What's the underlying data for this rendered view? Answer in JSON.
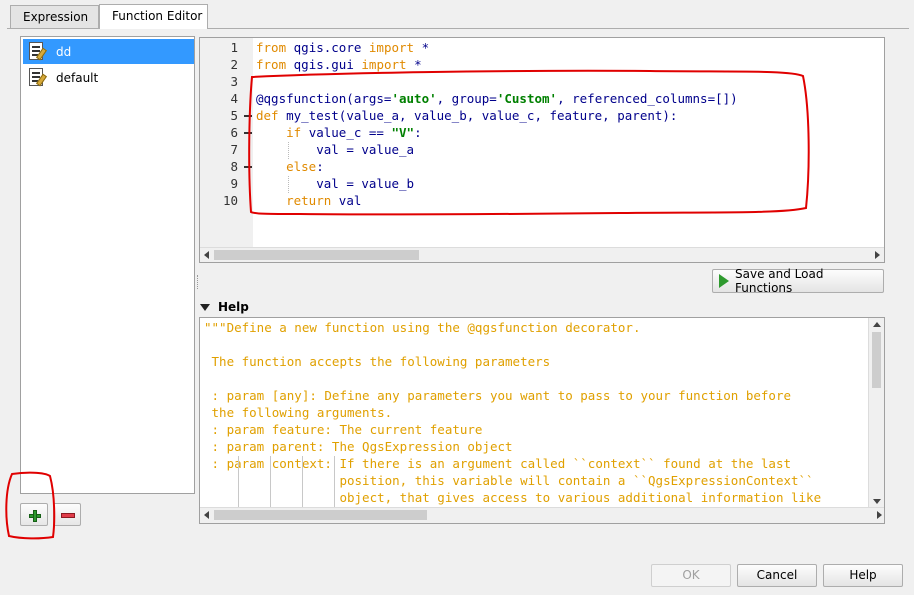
{
  "tabs": [
    {
      "label": "Expression",
      "active": false
    },
    {
      "label": "Function Editor",
      "active": true
    }
  ],
  "functions": [
    {
      "name": "dd",
      "selected": true
    },
    {
      "name": "default",
      "selected": false
    }
  ],
  "editor": {
    "line_numbers": [
      "1",
      "2",
      "3",
      "4",
      "5",
      "6",
      "7",
      "8",
      "9",
      "10"
    ],
    "lines": {
      "l1": {
        "kw1": "from",
        "mod": "qgis.core",
        "kw2": "import",
        "rest": "*"
      },
      "l2": {
        "kw1": "from",
        "mod": "qgis.gui",
        "kw2": "import",
        "rest": "*"
      },
      "l4": {
        "a": "@qgsfunction(args=",
        "b": "'auto'",
        "c": ", group=",
        "d": "'Custom'",
        "e": ", referenced_columns=[])"
      },
      "l5": {
        "kw": "def",
        "rest": "my_test(value_a, value_b, value_c, feature, parent):"
      },
      "l6": {
        "kw": "if",
        "a": "value_c == ",
        "b": "\"V\"",
        "c": ":"
      },
      "l7": {
        "text": "val = value_a"
      },
      "l8": {
        "kw": "else",
        "rest": ":"
      },
      "l9": {
        "text": "val = value_b"
      },
      "l10": {
        "kw": "return",
        "rest": "val"
      }
    }
  },
  "save_button": {
    "label": "Save and Load Functions"
  },
  "help": {
    "title": "Help",
    "lines": [
      "\"\"\"Define a new function using the @qgsfunction decorator.",
      "",
      " The function accepts the following parameters",
      "",
      " : param [any]: Define any parameters you want to pass to your function before",
      " the following arguments.",
      " : param feature: The current feature",
      " : param parent: The QgsExpression object",
      " : param context: If there is an argument called ``context`` found at the last",
      "                  position, this variable will contain a ``QgsExpressionContext``",
      "                  object, that gives access to various additional information like"
    ]
  },
  "dialog_buttons": {
    "ok": "OK",
    "cancel": "Cancel",
    "help": "Help"
  },
  "colors": {
    "selection": "#3399ff",
    "keyword": "#e08a00",
    "string": "#008000",
    "help_text": "#e0a000",
    "annotation": "#e00000"
  }
}
